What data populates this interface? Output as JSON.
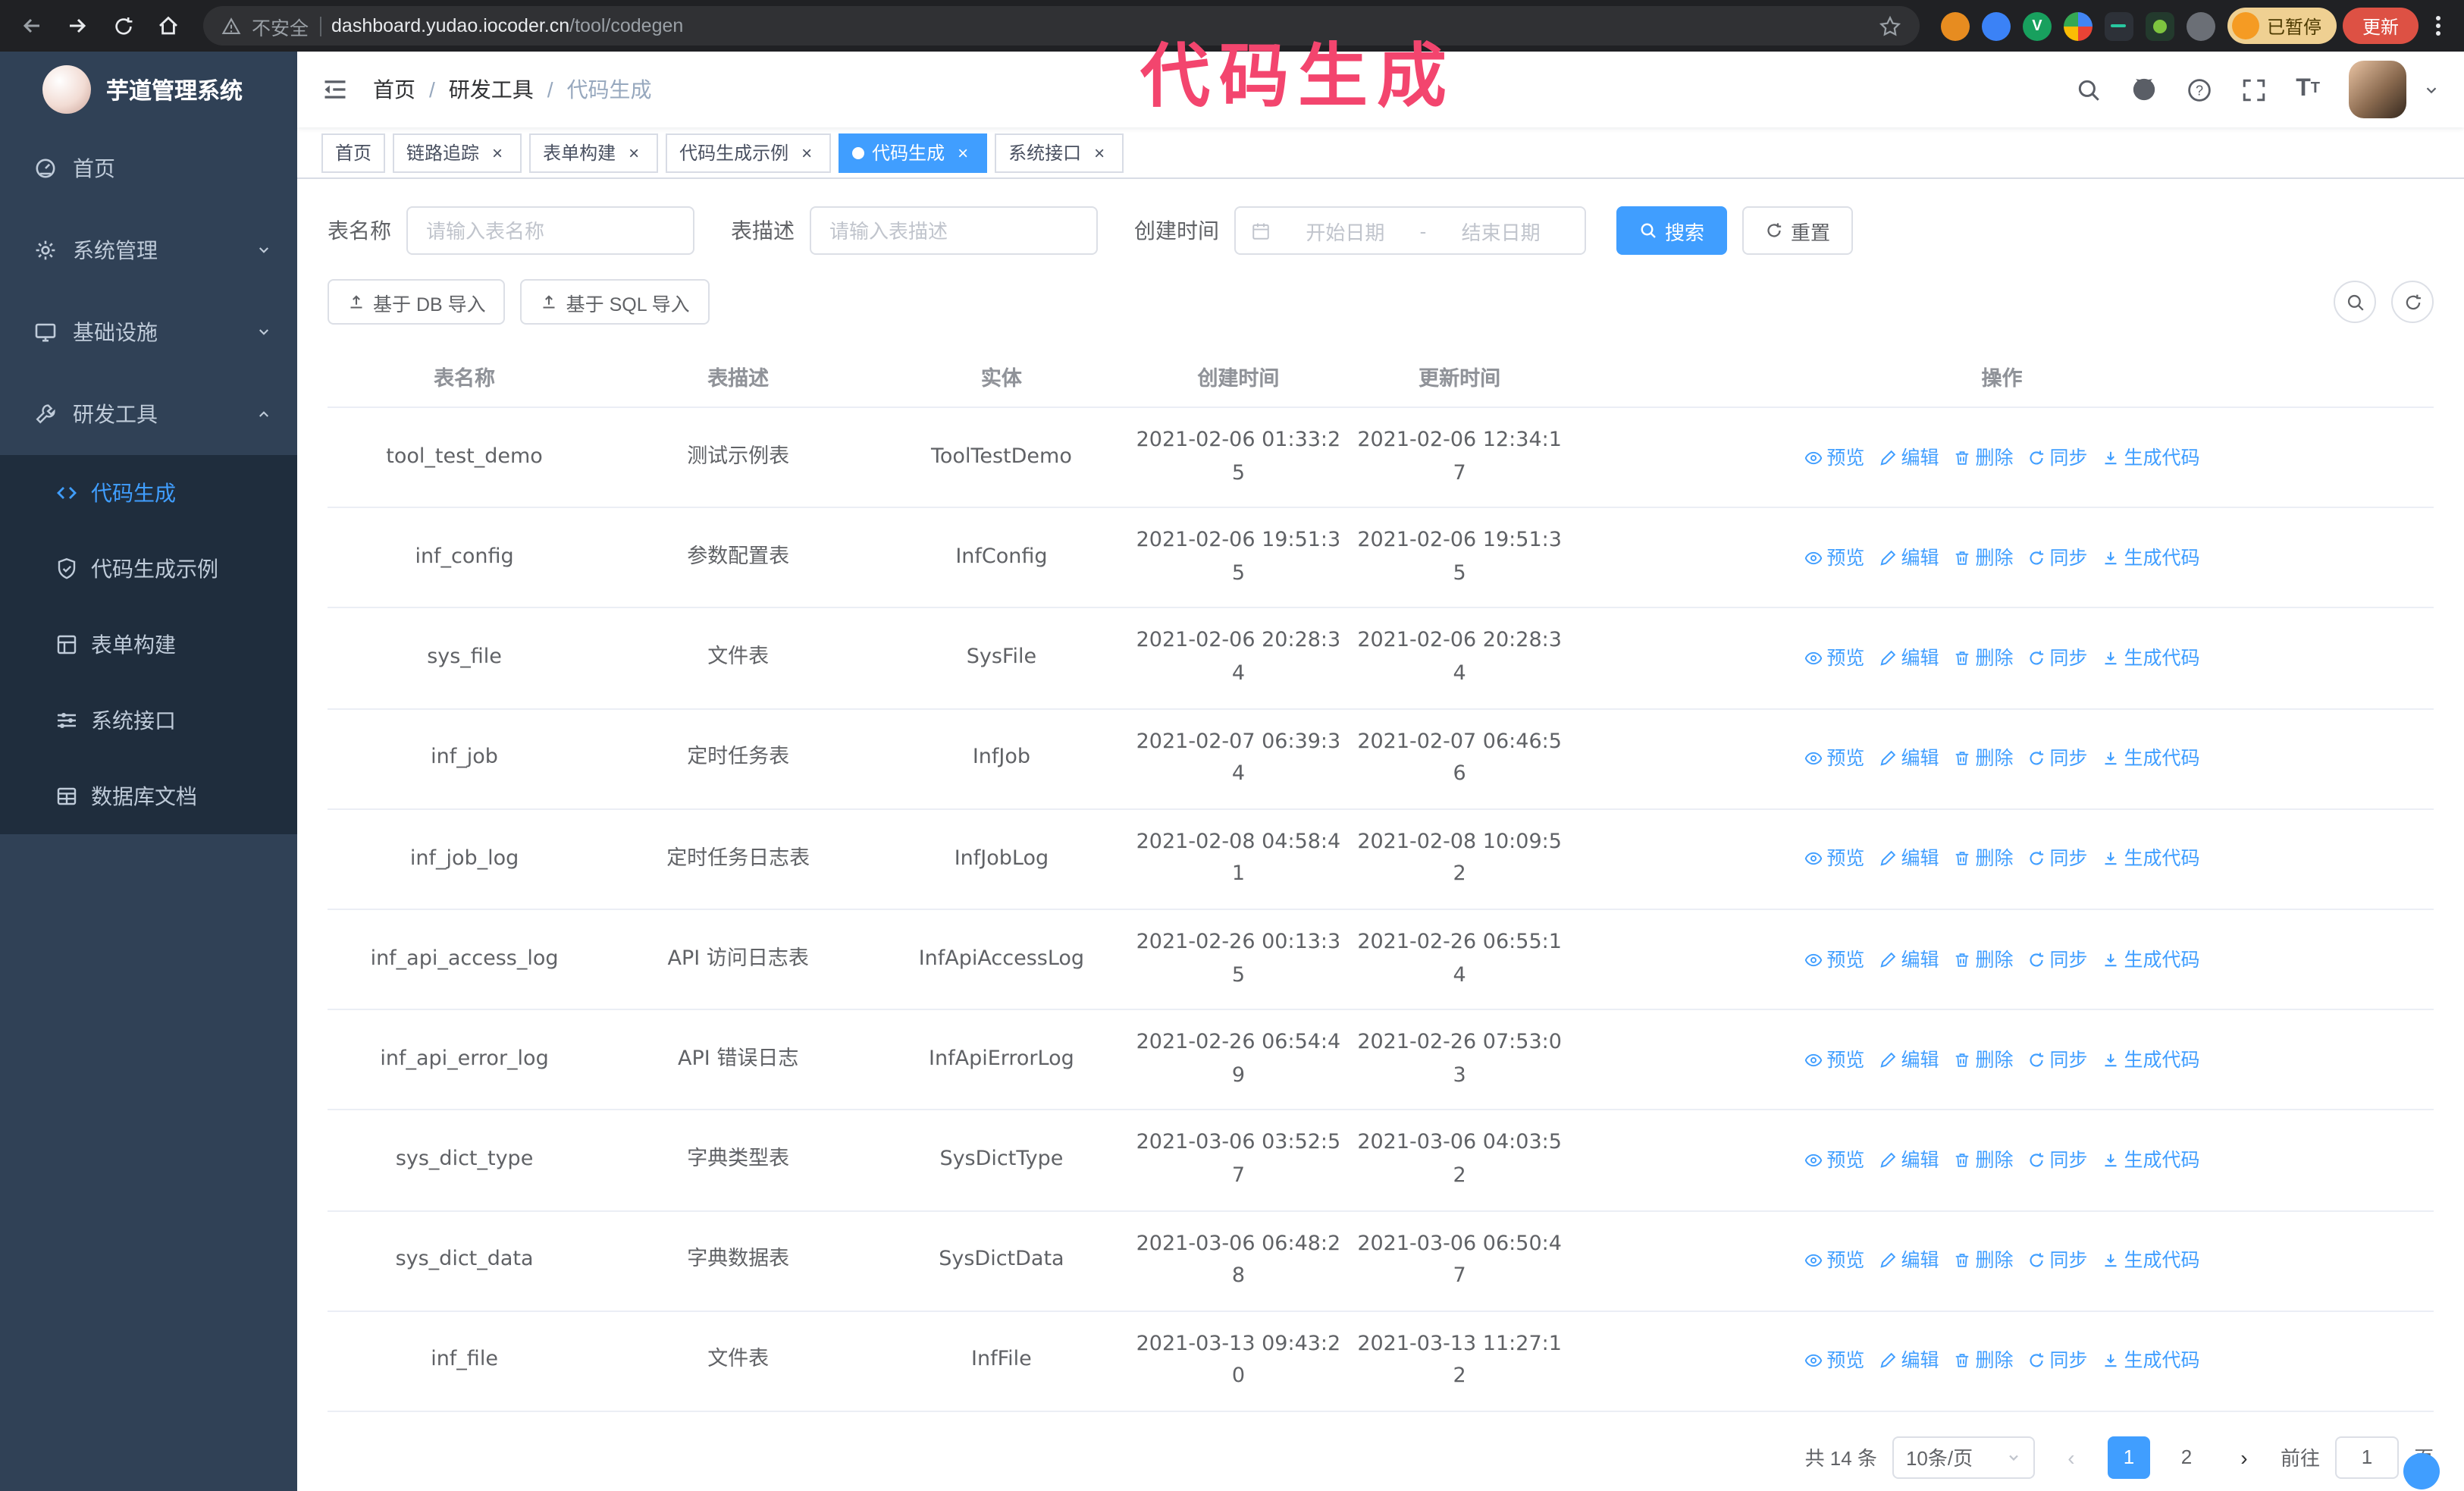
{
  "browser": {
    "security_label": "不安全",
    "url_host": "dashboard.yudao.iocoder.cn",
    "url_path": "/tool/codegen",
    "profile_badge": "已暂停",
    "update_button": "更新"
  },
  "annotation": {
    "text": "代码生成",
    "color": "#f3456e"
  },
  "sidebar": {
    "title": "芋道管理系统",
    "items": [
      {
        "label": "首页"
      },
      {
        "label": "系统管理"
      },
      {
        "label": "基础设施"
      },
      {
        "label": "研发工具"
      }
    ],
    "sub_items": [
      {
        "label": "代码生成"
      },
      {
        "label": "代码生成示例"
      },
      {
        "label": "表单构建"
      },
      {
        "label": "系统接口"
      },
      {
        "label": "数据库文档"
      }
    ]
  },
  "breadcrumb": {
    "items": [
      "首页",
      "研发工具",
      "代码生成"
    ],
    "separator": "/"
  },
  "tabs": [
    {
      "label": "首页"
    },
    {
      "label": "链路追踪"
    },
    {
      "label": "表单构建"
    },
    {
      "label": "代码生成示例"
    },
    {
      "label": "代码生成"
    },
    {
      "label": "系统接口"
    }
  ],
  "filters": {
    "name_label": "表名称",
    "name_placeholder": "请输入表名称",
    "desc_label": "表描述",
    "desc_placeholder": "请输入表描述",
    "time_label": "创建时间",
    "date_start": "开始日期",
    "date_sep": "-",
    "date_end": "结束日期",
    "search": "搜索",
    "reset": "重置"
  },
  "toolbar": {
    "import_db": "基于 DB 导入",
    "import_sql": "基于 SQL 导入"
  },
  "table": {
    "columns": [
      "表名称",
      "表描述",
      "实体",
      "创建时间",
      "更新时间",
      "操作"
    ],
    "actions": [
      "预览",
      "编辑",
      "删除",
      "同步",
      "生成代码"
    ],
    "rows": [
      {
        "name": "tool_test_demo",
        "desc": "测试示例表",
        "entity": "ToolTestDemo",
        "created": "2021-02-06 01:33:25",
        "updated": "2021-02-06 12:34:17"
      },
      {
        "name": "inf_config",
        "desc": "参数配置表",
        "entity": "InfConfig",
        "created": "2021-02-06 19:51:35",
        "updated": "2021-02-06 19:51:35"
      },
      {
        "name": "sys_file",
        "desc": "文件表",
        "entity": "SysFile",
        "created": "2021-02-06 20:28:34",
        "updated": "2021-02-06 20:28:34"
      },
      {
        "name": "inf_job",
        "desc": "定时任务表",
        "entity": "InfJob",
        "created": "2021-02-07 06:39:34",
        "updated": "2021-02-07 06:46:56"
      },
      {
        "name": "inf_job_log",
        "desc": "定时任务日志表",
        "entity": "InfJobLog",
        "created": "2021-02-08 04:58:41",
        "updated": "2021-02-08 10:09:52"
      },
      {
        "name": "inf_api_access_log",
        "desc": "API 访问日志表",
        "entity": "InfApiAccessLog",
        "created": "2021-02-26 00:13:35",
        "updated": "2021-02-26 06:55:14"
      },
      {
        "name": "inf_api_error_log",
        "desc": "API 错误日志",
        "entity": "InfApiErrorLog",
        "created": "2021-02-26 06:54:49",
        "updated": "2021-02-26 07:53:03"
      },
      {
        "name": "sys_dict_type",
        "desc": "字典类型表",
        "entity": "SysDictType",
        "created": "2021-03-06 03:52:57",
        "updated": "2021-03-06 04:03:52"
      },
      {
        "name": "sys_dict_data",
        "desc": "字典数据表",
        "entity": "SysDictData",
        "created": "2021-03-06 06:48:28",
        "updated": "2021-03-06 06:50:47"
      },
      {
        "name": "inf_file",
        "desc": "文件表",
        "entity": "InfFile",
        "created": "2021-03-13 09:43:20",
        "updated": "2021-03-13 11:27:12"
      }
    ]
  },
  "pagination": {
    "total_text": "共 14 条",
    "page_size": "10条/页",
    "pages": [
      "1",
      "2"
    ],
    "current_page": "1",
    "goto_label": "前往",
    "goto_value": "1",
    "goto_unit": "页"
  },
  "colors": {
    "accent": "#409eff",
    "sidebar_bg": "#304156",
    "submenu_bg": "#1f2d3d"
  }
}
